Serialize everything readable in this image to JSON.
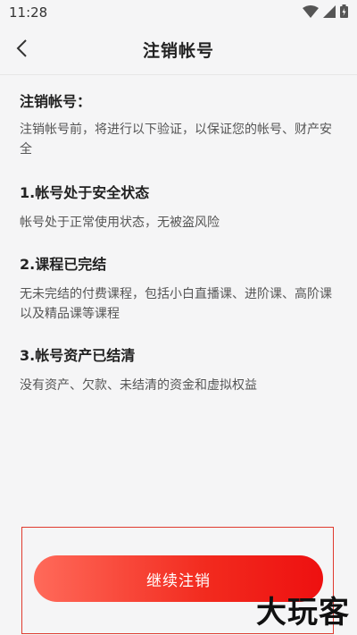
{
  "status_bar": {
    "time": "11:28",
    "icons": [
      "wifi-icon",
      "signal-icon",
      "battery-icon"
    ]
  },
  "nav": {
    "title": "注销帐号",
    "back_icon": "chevron-left-icon"
  },
  "intro": {
    "title": "注销帐号：",
    "description": "注销帐号前，将进行以下验证，以保证您的帐号、财产安全"
  },
  "sections": [
    {
      "title": "1.帐号处于安全状态",
      "description": "帐号处于正常使用状态，无被盗风险"
    },
    {
      "title": "2.课程已完结",
      "description": "无未完结的付费课程，包括小白直播课、进阶课、高阶课以及精品课等课程"
    },
    {
      "title": "3.帐号资产已结清",
      "description": "没有资产、欠款、未结清的资金和虚拟权益"
    }
  ],
  "footer": {
    "continue_label": "继续注销"
  },
  "watermark": "大玩客",
  "colors": {
    "accent_start": "#ff6a5a",
    "accent_end": "#ee1010",
    "highlight_border": "#e03a2e",
    "background": "#f5f5f6"
  }
}
